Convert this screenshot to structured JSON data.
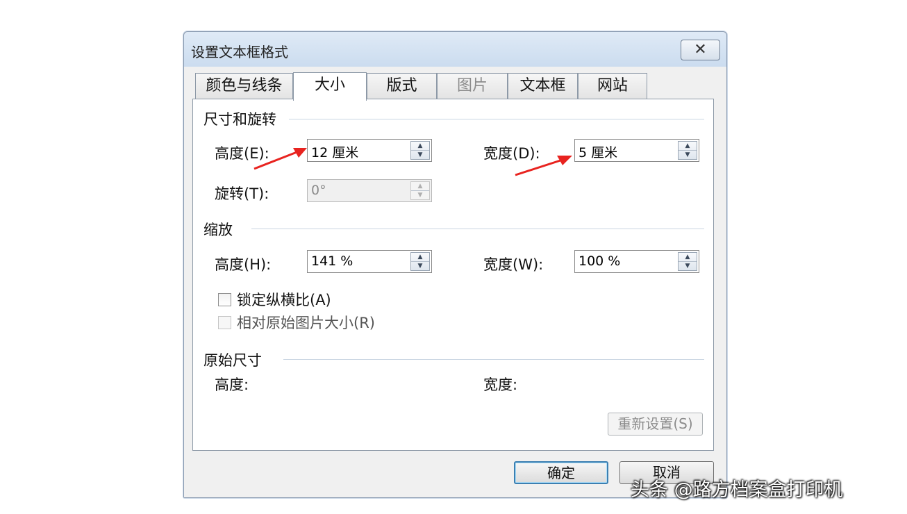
{
  "dialog": {
    "title": "设置文本框格式",
    "close_glyph": "✕"
  },
  "tabs": [
    {
      "label": "颜色与线条",
      "state": "normal"
    },
    {
      "label": "大小",
      "state": "active"
    },
    {
      "label": "版式",
      "state": "normal"
    },
    {
      "label": "图片",
      "state": "disabled"
    },
    {
      "label": "文本框",
      "state": "normal"
    },
    {
      "label": "网站",
      "state": "normal"
    }
  ],
  "size_rotate": {
    "title": "尺寸和旋转",
    "height_label": "高度(E):",
    "height_value": "12 厘米",
    "width_label": "宽度(D):",
    "width_value": "5 厘米",
    "rotate_label": "旋转(T):",
    "rotate_value": "0°"
  },
  "scale": {
    "title": "缩放",
    "height_label": "高度(H):",
    "height_value": "141 %",
    "width_label": "宽度(W):",
    "width_value": "100 %",
    "lock_ratio_label": "锁定纵横比(A)",
    "relative_label": "相对原始图片大小(R)"
  },
  "original": {
    "title": "原始尺寸",
    "height_label": "高度:",
    "width_label": "宽度:",
    "reset_label": "重新设置(S)"
  },
  "footer": {
    "ok_label": "确定",
    "cancel_label": "取消"
  },
  "annotation_color": "#e8231f",
  "watermark": "头条 @路方档案盒打印机"
}
